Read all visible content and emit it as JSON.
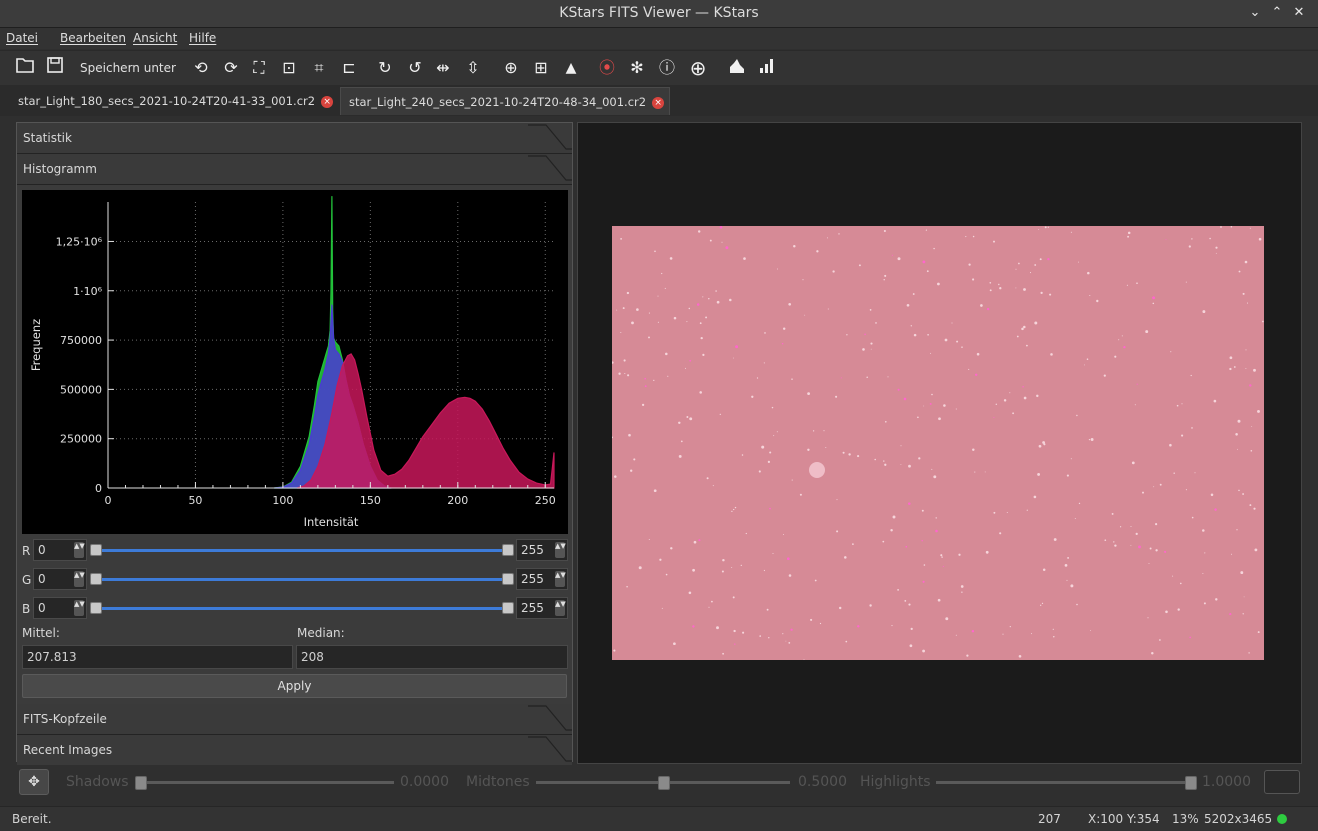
{
  "window": {
    "title": "KStars FITS Viewer — KStars",
    "buttons": [
      "⌄",
      "⌃",
      "✕"
    ]
  },
  "menu": [
    "Datei",
    "Bearbeiten",
    "Ansicht",
    "Hilfe"
  ],
  "toolbar": {
    "save_as_label": "Speichern unter ..."
  },
  "tabs": [
    {
      "label": "star_Light_180_secs_2021-10-24T20-41-33_001.cr2",
      "active": false
    },
    {
      "label": "star_Light_240_secs_2021-10-24T20-48-34_001.cr2",
      "active": true
    }
  ],
  "panel": {
    "sections": {
      "stats": "Statistik",
      "histogram": "Histogramm",
      "header": "FITS-Kopfzeile",
      "recent": "Recent Images"
    },
    "channels": [
      {
        "label": "R",
        "min": "0",
        "max": "255"
      },
      {
        "label": "G",
        "min": "0",
        "max": "255"
      },
      {
        "label": "B",
        "min": "0",
        "max": "255"
      }
    ],
    "mean_label": "Mittel:",
    "median_label": "Median:",
    "mean_value": "207.813",
    "median_value": "208",
    "apply_label": "Apply"
  },
  "chart_data": {
    "type": "area",
    "xlabel": "Intensität",
    "ylabel": "Frequenz",
    "xlim": [
      0,
      255
    ],
    "ylim": [
      0,
      1450000
    ],
    "x_ticks": [
      "0",
      "50",
      "100",
      "150",
      "200",
      "250"
    ],
    "y_ticks": [
      "0",
      "250000",
      "500000",
      "750000",
      "1·10⁶",
      "1,25·10⁶"
    ],
    "grid": true,
    "series": [
      {
        "color": "#22c23a",
        "x": [
          95,
          100,
          105,
          110,
          115,
          118,
          120,
          122,
          124,
          125,
          126,
          127,
          127.5,
          128,
          128.5,
          129,
          130,
          131,
          132,
          134,
          136,
          138,
          140,
          143,
          146,
          150,
          154,
          158,
          162
        ],
        "y": [
          0,
          5000,
          30000,
          110000,
          260000,
          420000,
          540000,
          600000,
          660000,
          690000,
          720000,
          800000,
          1000000,
          1480000,
          900000,
          760000,
          740000,
          730000,
          720000,
          650000,
          550000,
          470000,
          420000,
          330000,
          220000,
          110000,
          40000,
          10000,
          0
        ]
      },
      {
        "color": "#4b3ad6",
        "x": [
          95,
          100,
          105,
          110,
          115,
          118,
          120,
          122,
          124,
          125,
          126,
          127,
          128,
          129,
          130,
          132,
          134,
          136,
          138,
          140,
          143,
          146,
          150,
          154,
          158,
          162
        ],
        "y": [
          0,
          4000,
          25000,
          90000,
          220000,
          360000,
          470000,
          540000,
          600000,
          640000,
          680000,
          760000,
          930000,
          760000,
          700000,
          680000,
          640000,
          550000,
          470000,
          420000,
          330000,
          220000,
          110000,
          40000,
          10000,
          0
        ]
      },
      {
        "color": "#c8185a",
        "x": [
          108,
          112,
          116,
          120,
          124,
          128,
          131,
          134,
          137,
          139,
          141,
          143,
          145,
          148,
          152,
          156,
          160,
          164,
          168,
          172,
          176,
          180,
          185,
          190,
          195,
          200,
          204,
          207,
          210,
          214,
          218,
          222,
          226,
          230,
          235,
          240,
          245,
          250,
          253,
          254,
          255
        ],
        "y": [
          0,
          10000,
          40000,
          110000,
          220000,
          380000,
          520000,
          620000,
          670000,
          680000,
          650000,
          580000,
          500000,
          360000,
          190000,
          90000,
          60000,
          70000,
          95000,
          140000,
          200000,
          260000,
          320000,
          380000,
          430000,
          455000,
          460000,
          455000,
          440000,
          400000,
          340000,
          270000,
          200000,
          140000,
          80000,
          45000,
          25000,
          15000,
          20000,
          100000,
          180000
        ]
      }
    ]
  },
  "stretch": {
    "shadows_label": "Shadows",
    "shadows_value": "0.0000",
    "shadows_level": 0.0,
    "midtones_label": "Midtones",
    "midtones_value": "0.5000",
    "midtones_level": 0.5,
    "highlights_label": "Highlights",
    "highlights_value": "1.0000",
    "highlights_level": 1.0
  },
  "status": {
    "text": "Bereit.",
    "value": "207",
    "coords": "X:100 Y:354",
    "zoom": "13%",
    "size": "5202x3465",
    "indicator_color": "#2ecc40"
  }
}
